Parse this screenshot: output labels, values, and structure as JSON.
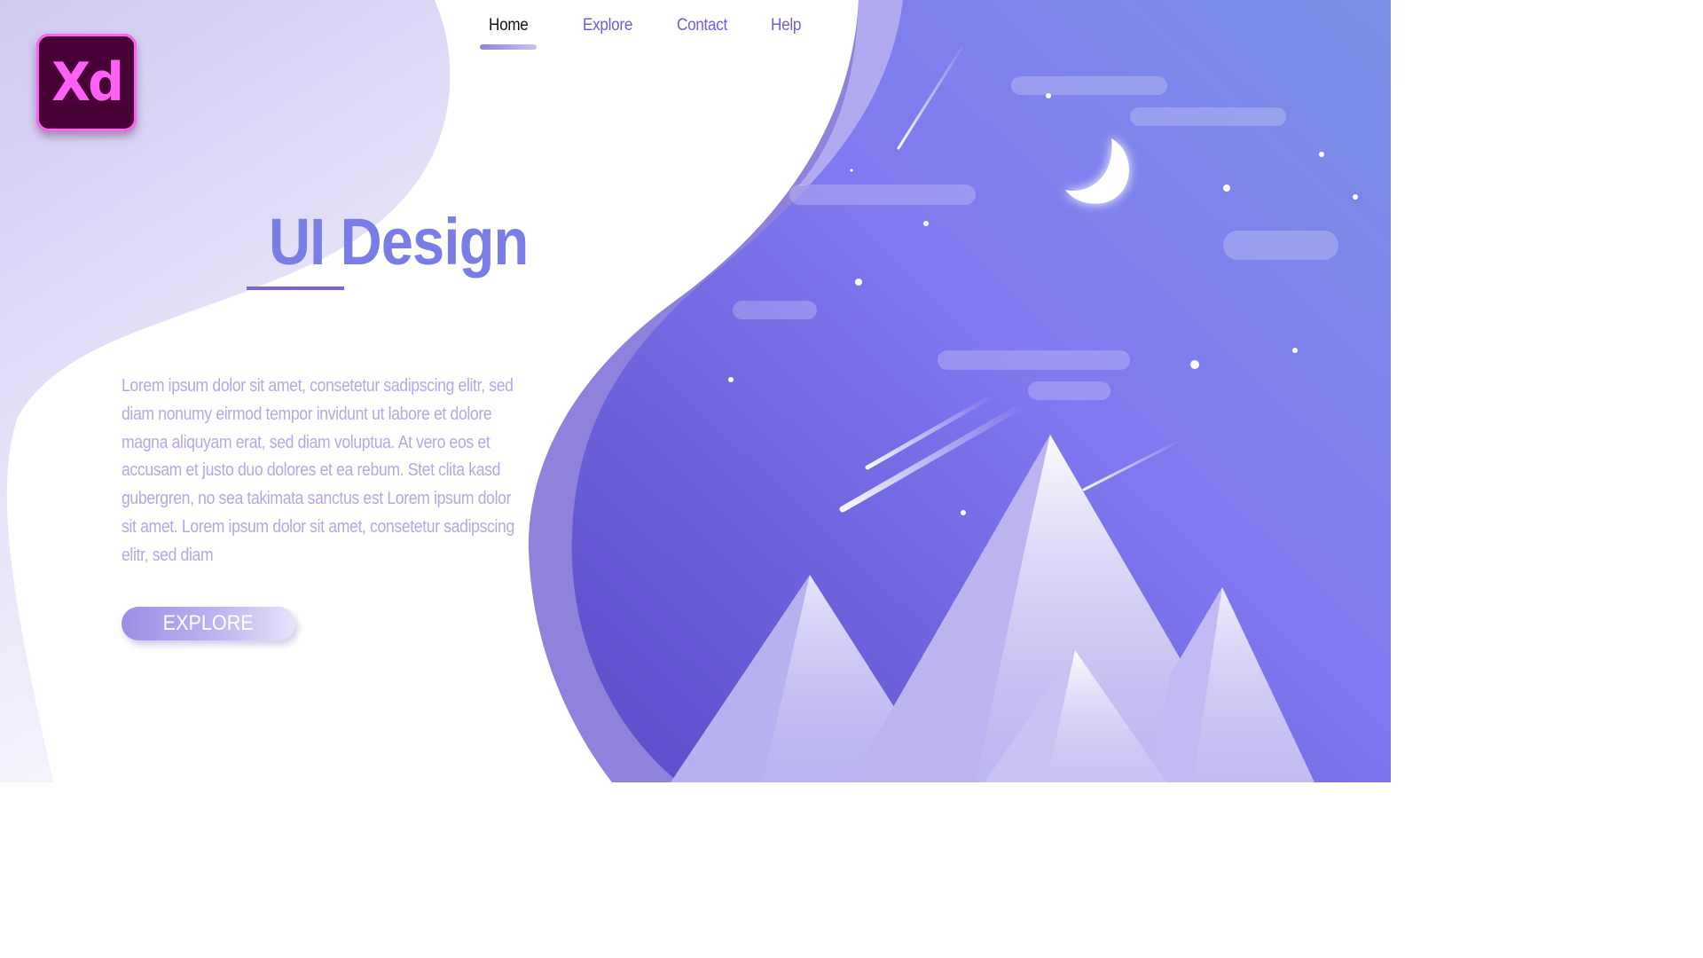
{
  "brand": {
    "logo_text": "Xd",
    "logo_icon": "adobe-xd-logo"
  },
  "nav": {
    "items": [
      {
        "label": "Home",
        "active": true
      },
      {
        "label": "Explore",
        "active": false
      },
      {
        "label": "Contact",
        "active": false
      },
      {
        "label": "Help",
        "active": false
      }
    ]
  },
  "hero": {
    "title": "UI Design",
    "body": "Lorem ipsum dolor sit amet, consetetur sadipscing elitr, sed diam nonumy eirmod tempor invidunt ut labore et dolore magna aliquyam erat, sed diam voluptua. At vero eos et accusam et justo duo dolores et ea rebum. Stet clita kasd gubergren, no sea takimata sanctus est Lorem ipsum dolor sit amet. Lorem ipsum dolor sit amet, consetetur sadipscing elitr, sed diam",
    "cta_label": "EXPLORE"
  },
  "colors": {
    "accent": "#7b7de6",
    "nav_text": "#6a5fd6",
    "body_text": "#b4a7ea",
    "night_sky": "#7e76ee",
    "logo_bg": "#470137",
    "logo_fg": "#ff61f6"
  },
  "illustration": {
    "scene": "night-sky-mountains",
    "icons": [
      "moon-icon",
      "star-icon",
      "cloud-icon",
      "shooting-star-icon",
      "mountain-icon"
    ]
  }
}
